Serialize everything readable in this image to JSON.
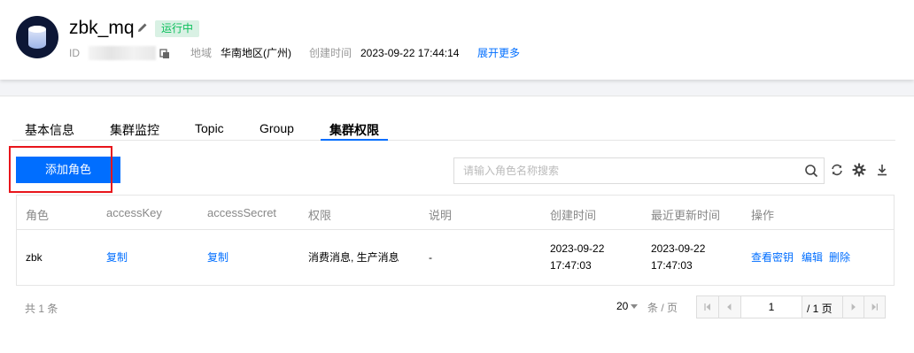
{
  "instance": {
    "name": "zbk_mq",
    "status": "运行中",
    "id_label": "ID",
    "region_label": "地域",
    "region_value": "华南地区(广州)",
    "created_label": "创建时间",
    "created_value": "2023-09-22 17:44:14",
    "expand_label": "展开更多"
  },
  "tabs": [
    {
      "label": "基本信息"
    },
    {
      "label": "集群监控"
    },
    {
      "label": "Topic"
    },
    {
      "label": "Group"
    },
    {
      "label": "集群权限",
      "active": true
    }
  ],
  "toolbar": {
    "add_label": "添加角色",
    "search_placeholder": "请输入角色名称搜索"
  },
  "table": {
    "headers": [
      "角色",
      "accessKey",
      "accessSecret",
      "权限",
      "说明",
      "创建时间",
      "最近更新时间",
      "操作"
    ],
    "rows": [
      {
        "role": "zbk",
        "access_key": "复制",
        "access_secret": "复制",
        "permission": "消费消息, 生产消息",
        "desc": "-",
        "created_date": "2023-09-22",
        "created_time": "17:47:03",
        "updated_date": "2023-09-22",
        "updated_time": "17:47:03",
        "actions": [
          "查看密钥",
          "编辑",
          "删除"
        ]
      }
    ]
  },
  "pagination": {
    "total": "共 1 条",
    "page_size": "20",
    "page_unit": "条 / 页",
    "current_page": "1",
    "total_pages": "/ 1 页"
  },
  "colors": {
    "accent": "#006eff",
    "status_text": "#0abf5b",
    "status_bg": "#d9f1e4",
    "highlight": "#e8151b"
  },
  "icons": [
    "database-icon",
    "edit-icon",
    "copy-icon",
    "search-icon",
    "refresh-icon",
    "settings-icon",
    "download-icon",
    "first-page-icon",
    "prev-page-icon",
    "next-page-icon",
    "last-page-icon"
  ]
}
